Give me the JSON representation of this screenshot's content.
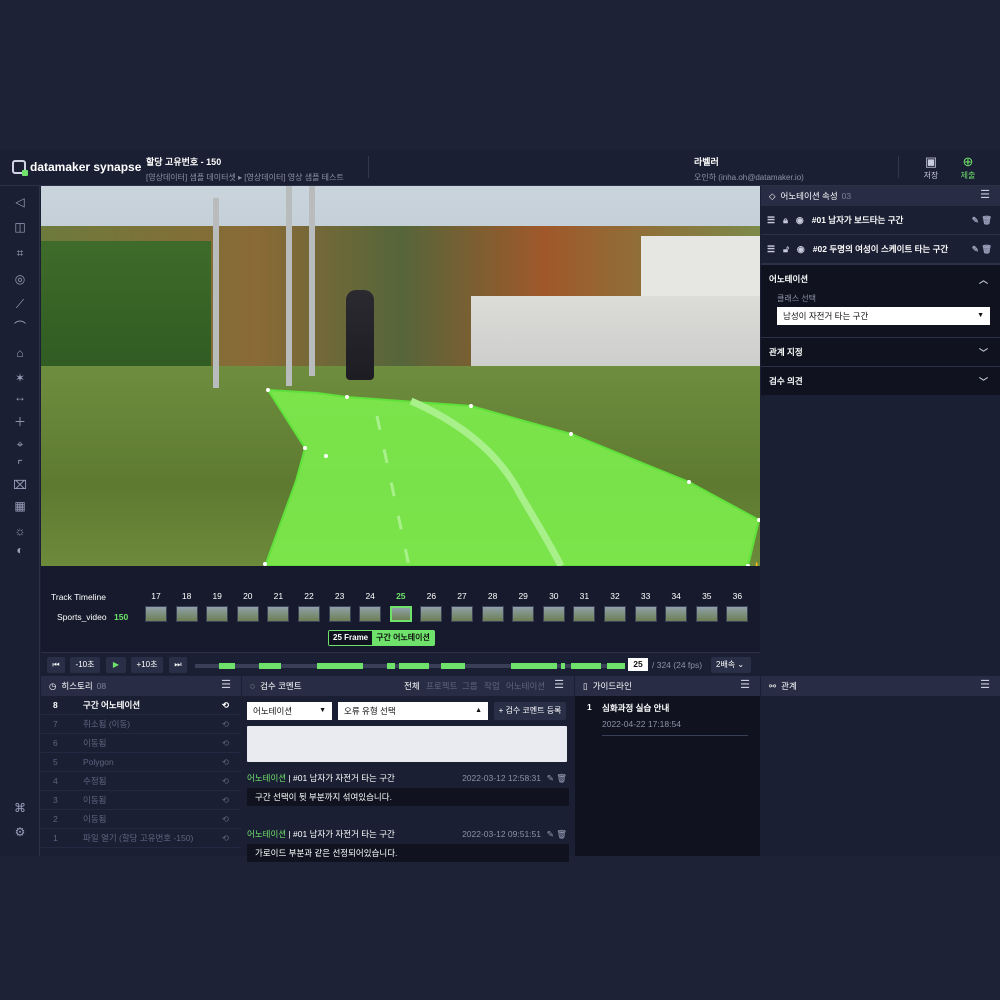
{
  "app": {
    "logo": "datamaker synapse",
    "project_title": "할당 고유번호 - 150",
    "project_path": "[영상데이터] 샘플 데이터셋 ▸ [영상데이터] 영상 샘플 테스트",
    "labeler_title": "라벨러",
    "labeler_user": "오인하 (inha.oh@datamaker.io)",
    "save_label": "저장",
    "submit_label": "제출"
  },
  "timeline": {
    "title": "Track Timeline",
    "video": "Sports_video",
    "video_count": "150",
    "frames": [
      "17",
      "18",
      "19",
      "20",
      "21",
      "22",
      "23",
      "24",
      "25",
      "26",
      "27",
      "28",
      "29",
      "30",
      "31",
      "32",
      "33",
      "34",
      "35",
      "36"
    ],
    "active_frame": "25",
    "tag_frame": "25 Frame",
    "tag_label": "구간 어노테이션"
  },
  "controls": {
    "back": "-10초",
    "fwd": "+10초",
    "current": "25",
    "total": "/ 324  (24 fps)",
    "speed": "2배속"
  },
  "ann_panel": {
    "title": "어노테이션 속성",
    "count": "03",
    "items": [
      {
        "label": "#01 남자가 보드타는 구간"
      },
      {
        "label": "#02 두명의 여성이 스케이트 타는 구간"
      }
    ],
    "section_ann": "어노테이션",
    "class_label": "클래스 선택",
    "class_value": "남성이 자전거 타는 구간",
    "section_rel": "관계 지정",
    "section_review": "검수 의견"
  },
  "history": {
    "title": "히스토리",
    "count": "08",
    "rows": [
      {
        "n": "8",
        "label": "구간 어노테이션"
      },
      {
        "n": "7",
        "label": "취소됨 (이동)"
      },
      {
        "n": "6",
        "label": "이동됨"
      },
      {
        "n": "5",
        "label": "Polygon"
      },
      {
        "n": "4",
        "label": "수정됨"
      },
      {
        "n": "3",
        "label": "이동됨"
      },
      {
        "n": "2",
        "label": "이동됨"
      },
      {
        "n": "1",
        "label": "파일 열기 (할당 고유번호 -150)"
      }
    ]
  },
  "review": {
    "title": "검수 코멘트",
    "tabs": [
      "전체",
      "프로젝트",
      "그룹",
      "작업",
      "어노테이션"
    ],
    "select1": "어노테이션",
    "select2": "오류 유형 선택",
    "register": "+ 검수 코멘트 등록",
    "comments": [
      {
        "type": "어노테이션",
        "title": "#01 남자가 자전거 타는 구간",
        "date": "2022-03-12 12:58:31",
        "body": "구간 선택이 뒷 부분까지 섞여있습니다."
      },
      {
        "type": "어노테이션",
        "title": "#01 남자가 자전거 타는 구간",
        "date": "2022-03-12 09:51:51",
        "body": "가로이드 부분과 같은 선정되어있습니다."
      }
    ]
  },
  "guide": {
    "title": "가이드라인",
    "items": [
      {
        "n": "1",
        "title": "심화과정 실습 안내",
        "date": "2022-04-22 17:18:54"
      }
    ]
  },
  "relation": {
    "title": "관계"
  },
  "colors": {
    "accent": "#6ee26b",
    "panel": "#1b1f33",
    "header": "#282d45"
  }
}
